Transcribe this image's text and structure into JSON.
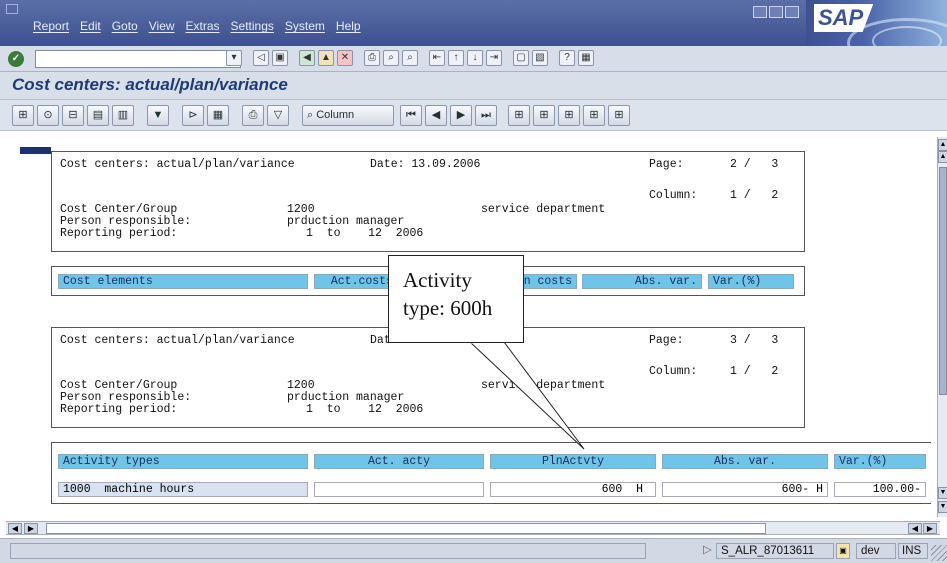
{
  "menu": [
    "Report",
    "Edit",
    "Goto",
    "View",
    "Extras",
    "Settings",
    "System",
    "Help"
  ],
  "brand": "SAP",
  "title": "Cost centers: actual/plan/variance",
  "toolbar": {
    "column_label": "Column"
  },
  "reports": [
    {
      "title": "Cost centers: actual/plan/variance",
      "date": "Date: 13.09.2006",
      "page_label": "Page:",
      "page_value": "2 /   3",
      "column_label": "Column:",
      "column_value": "1 /   2",
      "cc_label": "Cost Center/Group",
      "cc_value": "1200",
      "cc_desc": "service department",
      "person_label": "Person responsible:",
      "person_value": "prduction manager",
      "period_label": "Reporting period:",
      "period_value": "1  to    12  2006"
    },
    {
      "title": "Cost centers: actual/plan/variance",
      "date": "Date: 13.09.2006",
      "page_label": "Page:",
      "page_value": "3 /   3",
      "column_label": "Column:",
      "column_value": "1 /   2",
      "cc_label": "Cost Center/Group",
      "cc_value": "1200",
      "cc_desc": "service department",
      "person_label": "Person responsible:",
      "person_value": "prduction manager",
      "period_label": "Reporting period:",
      "period_value": "1  to    12  2006"
    }
  ],
  "cost_table": {
    "headers": [
      "Cost elements",
      "Act.costs",
      "Plan costs",
      "Abs. var.",
      "Var.(%)"
    ]
  },
  "activity_table": {
    "headers": [
      "Activity types",
      "Act. acty",
      "PlnActvty",
      "Abs. var.",
      "Var.(%)"
    ],
    "rows": [
      [
        "1000  machine hours",
        "",
        "600  H",
        "600- H",
        "100.00-"
      ]
    ]
  },
  "callout": {
    "line1": "Activity",
    "line2": "type: 600h"
  },
  "status": {
    "program": "S_ALR_87013611",
    "client": "dev",
    "mode": "INS"
  }
}
